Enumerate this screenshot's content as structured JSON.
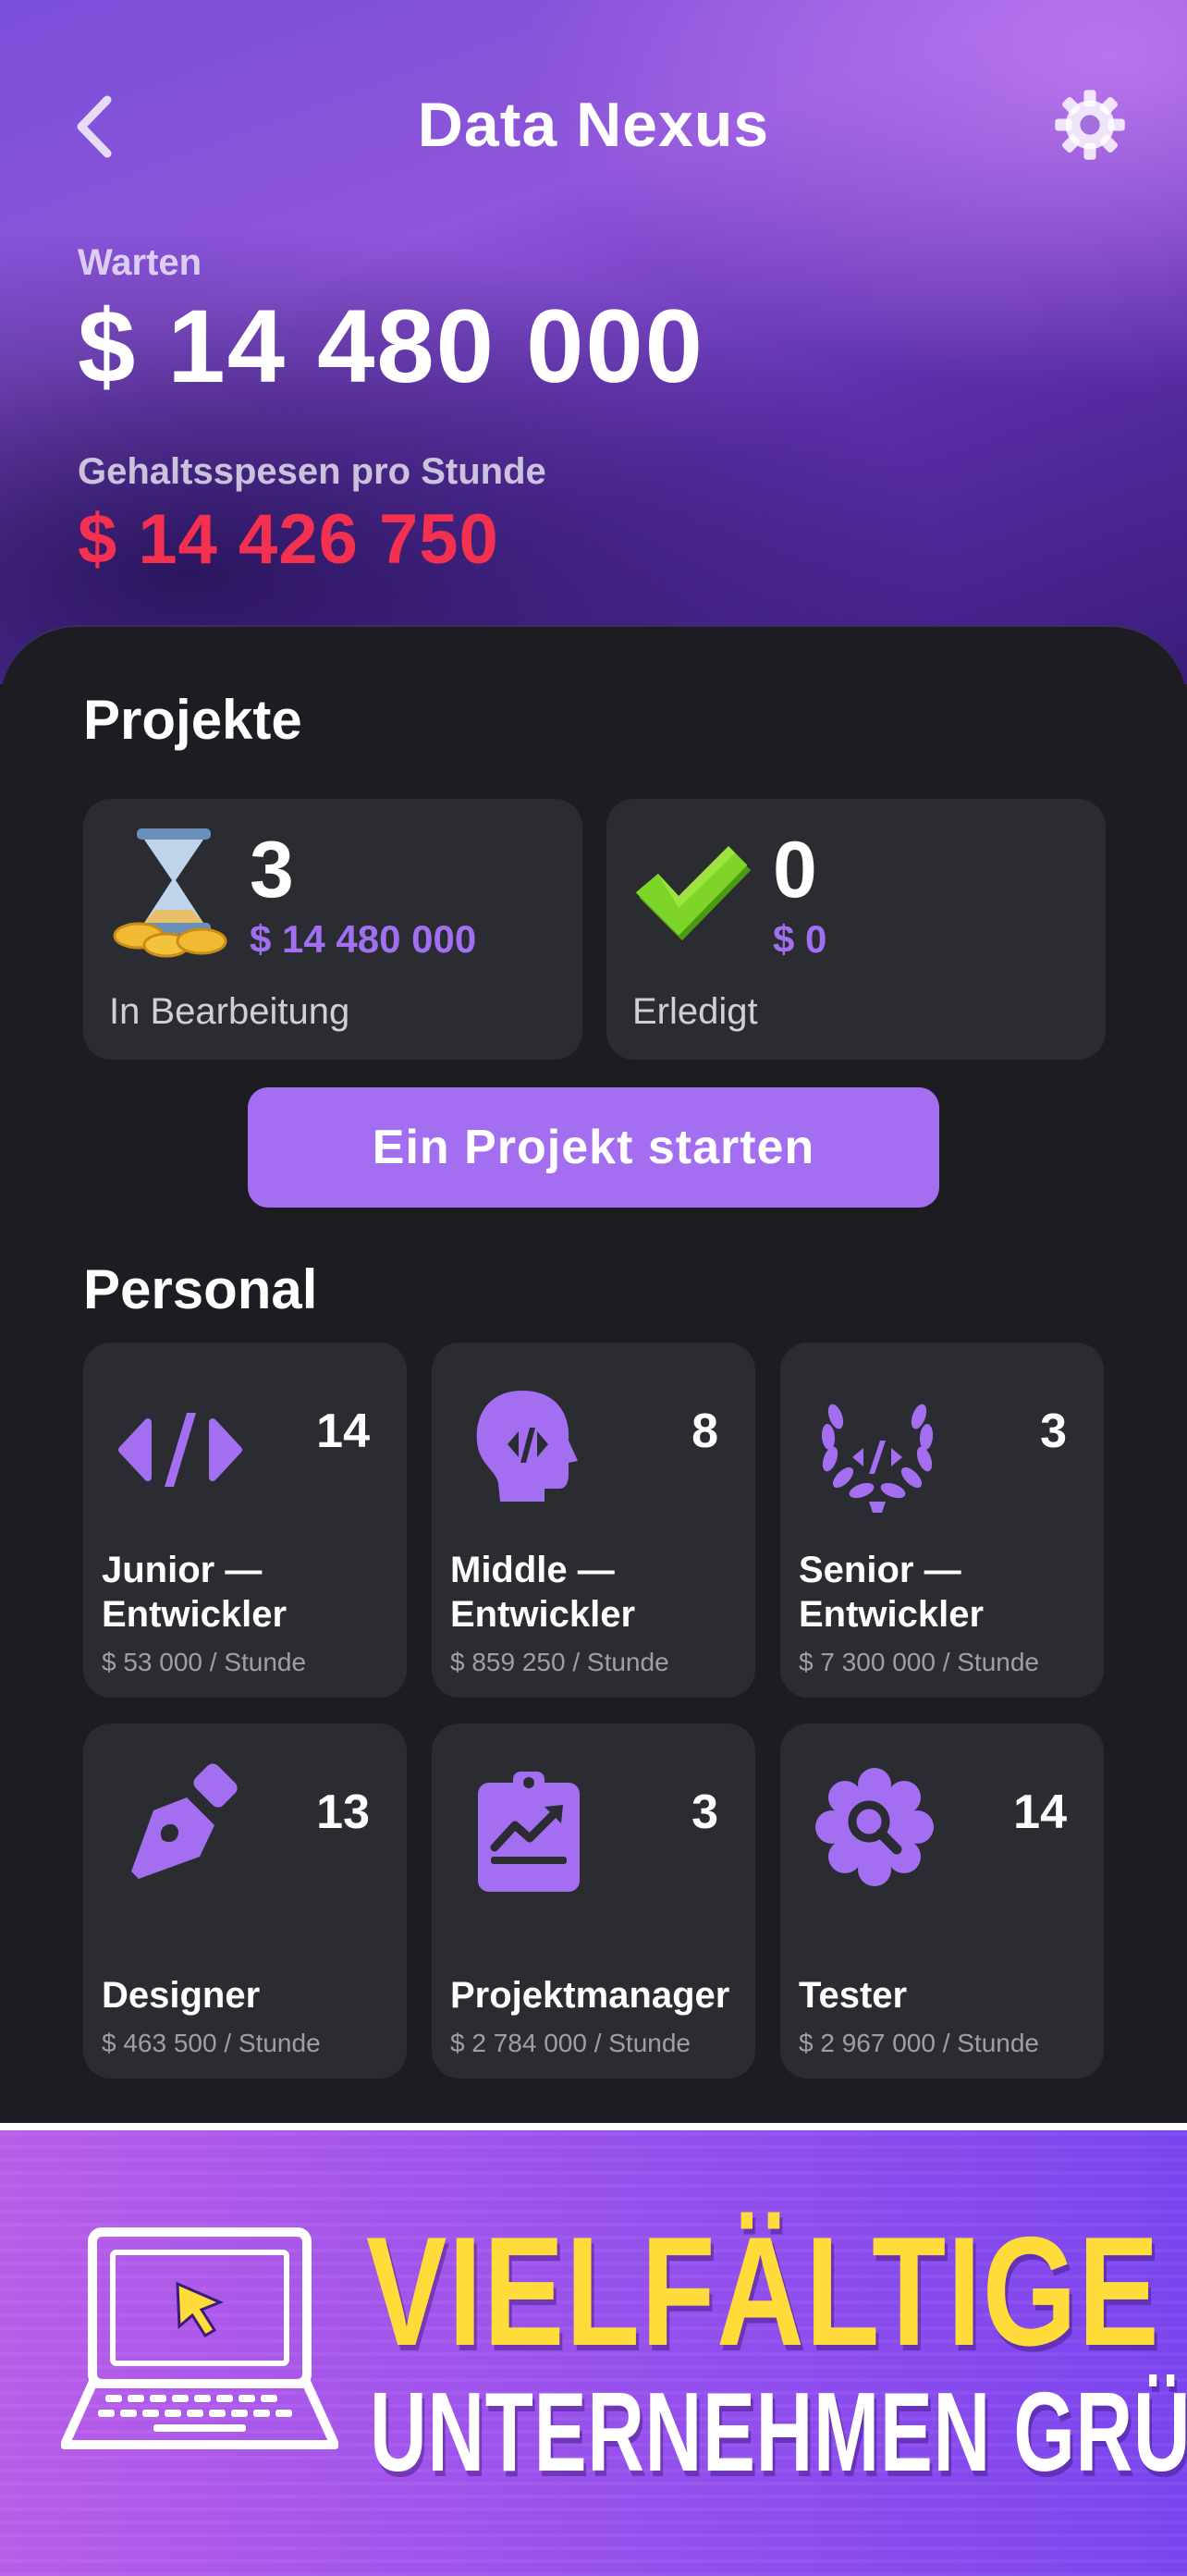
{
  "header": {
    "title": "Data Nexus",
    "back_icon": "chevron-left-icon",
    "settings_icon": "gear-icon"
  },
  "balance": {
    "label": "Warten",
    "value": "$ 14 480 000"
  },
  "salary": {
    "label": "Gehaltsspesen pro Stunde",
    "value": "$ 14 426 750",
    "color": "#f3304f"
  },
  "projects": {
    "title": "Projekte",
    "cards": [
      {
        "count": "3",
        "amount": "$ 14 480 000",
        "status": "In Bearbeitung",
        "icon": "hourglass-coins-icon"
      },
      {
        "count": "0",
        "amount": "$ 0",
        "status": "Erledigt",
        "icon": "checkmark-icon"
      }
    ],
    "start_button": "Ein Projekt starten"
  },
  "personal": {
    "title": "Personal",
    "staff": [
      {
        "name": "Junior —\nEntwickler",
        "count": "14",
        "rate": "$ 53 000 / Stunde",
        "icon": "code-icon"
      },
      {
        "name": "Middle —\nEntwickler",
        "count": "8",
        "rate": "$ 859 250 / Stunde",
        "icon": "head-code-icon"
      },
      {
        "name": "Senior —\nEntwickler",
        "count": "3",
        "rate": "$ 7 300 000 / Stunde",
        "icon": "laurel-code-icon"
      },
      {
        "name": "Designer",
        "count": "13",
        "rate": "$ 463 500 / Stunde",
        "icon": "pen-nib-icon"
      },
      {
        "name": "Projektmanager",
        "count": "3",
        "rate": "$ 2 784 000 / Stunde",
        "icon": "clipboard-chart-icon"
      },
      {
        "name": "Tester",
        "count": "14",
        "rate": "$ 2 967 000 / Stunde",
        "icon": "gear-search-icon"
      }
    ]
  },
  "banner": {
    "line1": "VIELFÄLTIGE",
    "line2": "UNTERNEHMEN GRÜNDEN",
    "icon": "laptop-cursor-icon"
  },
  "colors": {
    "accent": "#a36ef0",
    "card": "#2b2b32",
    "panel": "#1c1c22",
    "banner_yellow": "#ffdc3a"
  }
}
